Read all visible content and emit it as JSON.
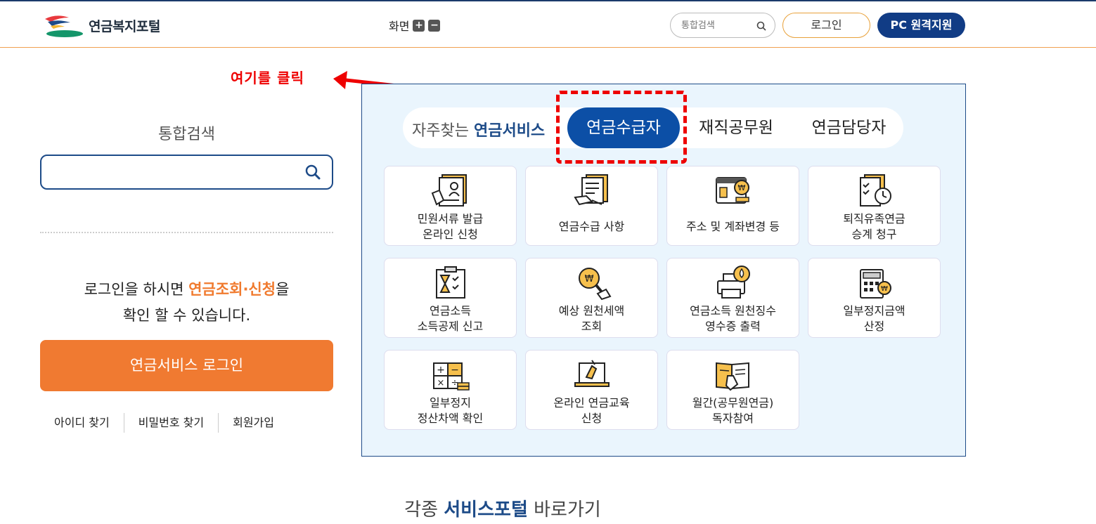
{
  "header": {
    "logo_text": "연금복지포털",
    "zoom_label": "화면",
    "zoom_in": "+",
    "zoom_out": "−",
    "search_placeholder": "통합검색",
    "login_label": "로그인",
    "remote_label": "PC 원격지원"
  },
  "annotation": {
    "text": "여기를 클릭"
  },
  "sidebar": {
    "search_title": "통합검색",
    "login_message_pre": "로그인을 하시면 ",
    "login_message_hl": "연금조회·신청",
    "login_message_post1": "을",
    "login_message_line2": "확인 할 수 있습니다.",
    "login_button": "연금서비스 로그인",
    "links": [
      "아이디 찾기",
      "비밀번호 찾기",
      "회원가입"
    ]
  },
  "services": {
    "label_pre": "자주찾는 ",
    "label_hl": "연금서비스",
    "tabs": [
      "연금수급자",
      "재직공무원",
      "연금담당자"
    ],
    "cards": [
      {
        "label": "민원서류 발급\n온라인 신청",
        "icon": "certificate-icon"
      },
      {
        "label": "연금수급 사항",
        "icon": "document-hand-icon"
      },
      {
        "label": "주소 및 계좌변경 등",
        "icon": "card-coin-icon"
      },
      {
        "label": "퇴직유족연금\n승계 청구",
        "icon": "checklist-clock-icon"
      },
      {
        "label": "연금소득\n소득공제 신고",
        "icon": "hourglass-clipboard-icon"
      },
      {
        "label": "예상 원천세액\n조회",
        "icon": "magnifier-won-icon"
      },
      {
        "label": "연금소득 원천징수\n영수증 출력",
        "icon": "printer-icon"
      },
      {
        "label": "일부정지금액\n산정",
        "icon": "calculator-won-icon"
      },
      {
        "label": "일부정지\n정산차액 확인",
        "icon": "math-coins-icon"
      },
      {
        "label": "온라인 연금교육\n신청",
        "icon": "laptop-hand-icon"
      },
      {
        "label": "월간(공무원연금)\n독자참여",
        "icon": "book-hand-icon"
      }
    ]
  },
  "footer": {
    "title_pre": "각종 ",
    "title_hl": "서비스포털",
    "title_post": " 바로가기"
  }
}
